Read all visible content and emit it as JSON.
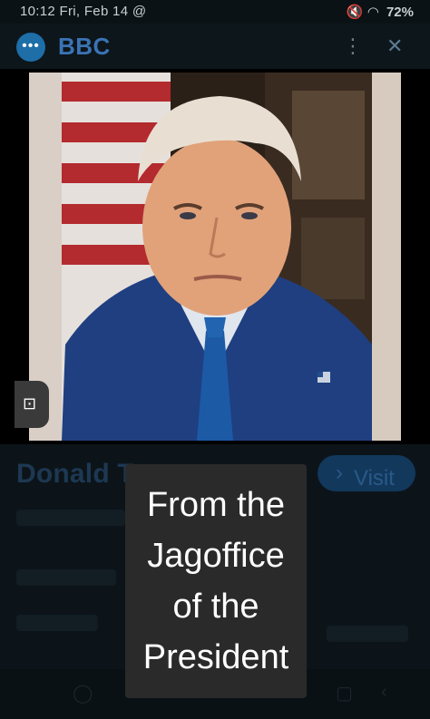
{
  "status_bar": {
    "time": "10:12",
    "date": "Fri, Feb 14",
    "battery": "72%",
    "icons": [
      "threads-icon",
      "mute-icon",
      "wifi-icon",
      "battery-icon"
    ]
  },
  "header": {
    "title": "BBC",
    "logo_icon": "chat-dots-icon",
    "menu_icon": "more-vert-icon",
    "close_icon": "close-icon"
  },
  "photo": {
    "subject": "portrait",
    "lens_icon": "lens-icon"
  },
  "result": {
    "title": "Donald T",
    "visit_label": "Visit"
  },
  "caption": {
    "lines": [
      "From the",
      "Jagoffice",
      "of the",
      "President"
    ]
  },
  "colors": {
    "accent": "#3b73b5",
    "caption_bg": "#2a2a2a",
    "caption_text": "#ffffff"
  }
}
